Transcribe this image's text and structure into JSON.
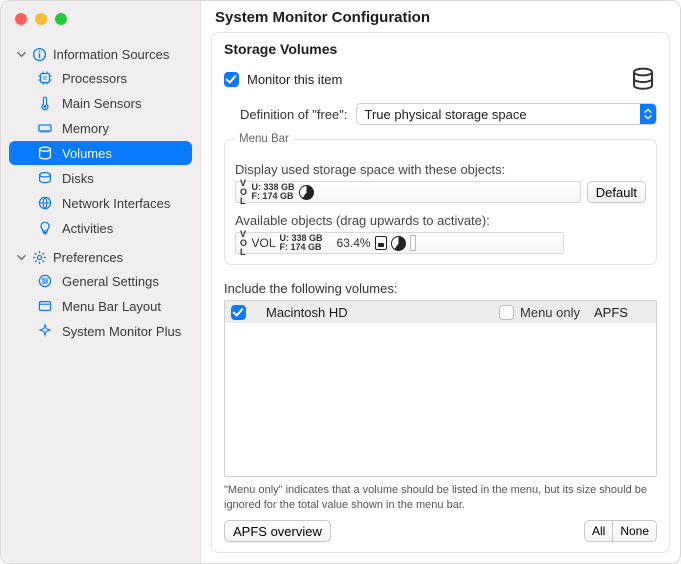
{
  "window_title": "System Monitor Configuration",
  "sidebar": {
    "information_sources": {
      "label": "Information Sources",
      "items": [
        {
          "label": "Processors"
        },
        {
          "label": "Main Sensors"
        },
        {
          "label": "Memory"
        },
        {
          "label": "Volumes"
        },
        {
          "label": "Disks"
        },
        {
          "label": "Network Interfaces"
        },
        {
          "label": "Activities"
        }
      ]
    },
    "preferences": {
      "label": "Preferences",
      "items": [
        {
          "label": "General Settings"
        },
        {
          "label": "Menu Bar Layout"
        },
        {
          "label": "System Monitor Plus"
        }
      ]
    }
  },
  "content": {
    "title": "Storage Volumes",
    "monitor_label": "Monitor this item",
    "definition_label": "Definition of \"free\":",
    "definition_value": "True physical storage space",
    "menu_bar": {
      "group_label": "Menu Bar",
      "display_label": "Display used storage space with these objects:",
      "used_row": {
        "vol_tag": "V\nO\nL",
        "used_line": "U: 338 GB",
        "free_line": "F:  174 GB"
      },
      "default_btn": "Default",
      "available_label": "Available objects (drag upwards to activate):",
      "avail_row": {
        "vol_tag": "V\nO\nL",
        "vol_word": "VOL",
        "used_line": "U: 338 GB",
        "free_line": "F:  174 GB",
        "percent": "63.4%"
      }
    },
    "include_label": "Include the following volumes:",
    "volumes": [
      {
        "name": "Macintosh HD",
        "menu_only_label": "Menu only",
        "fs": "APFS",
        "checked": true,
        "menu_only": false
      }
    ],
    "footnote": "\"Menu only\" indicates that a volume should be listed in the menu, but its size should be ignored for the total value shown in the menu bar.",
    "apfs_btn": "APFS overview",
    "all_btn": "All",
    "none_btn": "None"
  }
}
